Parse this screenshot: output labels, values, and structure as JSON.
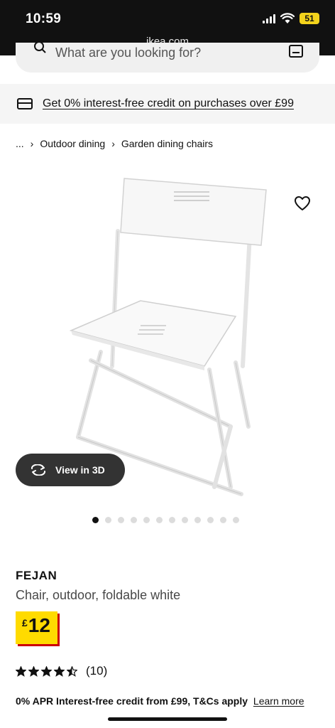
{
  "status_bar": {
    "time": "10:59",
    "battery": "51",
    "url": "ikea.com"
  },
  "search": {
    "placeholder": "What are you looking for?"
  },
  "credit_banner": {
    "text": "Get 0% interest-free credit on purchases over £99"
  },
  "breadcrumb": {
    "items": [
      "...",
      "Outdoor dining",
      "Garden dining chairs"
    ]
  },
  "gallery": {
    "view_3d_label": "View in 3D",
    "dot_count": 12,
    "active_dot": 0
  },
  "product": {
    "name": "FEJAN",
    "description": "Chair, outdoor, foldable white",
    "price_currency": "£",
    "price_amount": "12",
    "rating_stars": 4.5,
    "rating_count": "(10)"
  },
  "finance": {
    "text": "0% APR Interest-free credit from £99, T&Cs apply",
    "link": "Learn more"
  },
  "colors": {
    "price_yellow": "#ffdb00",
    "price_shadow": "#cc0008",
    "battery_yellow": "#f3d31c"
  }
}
